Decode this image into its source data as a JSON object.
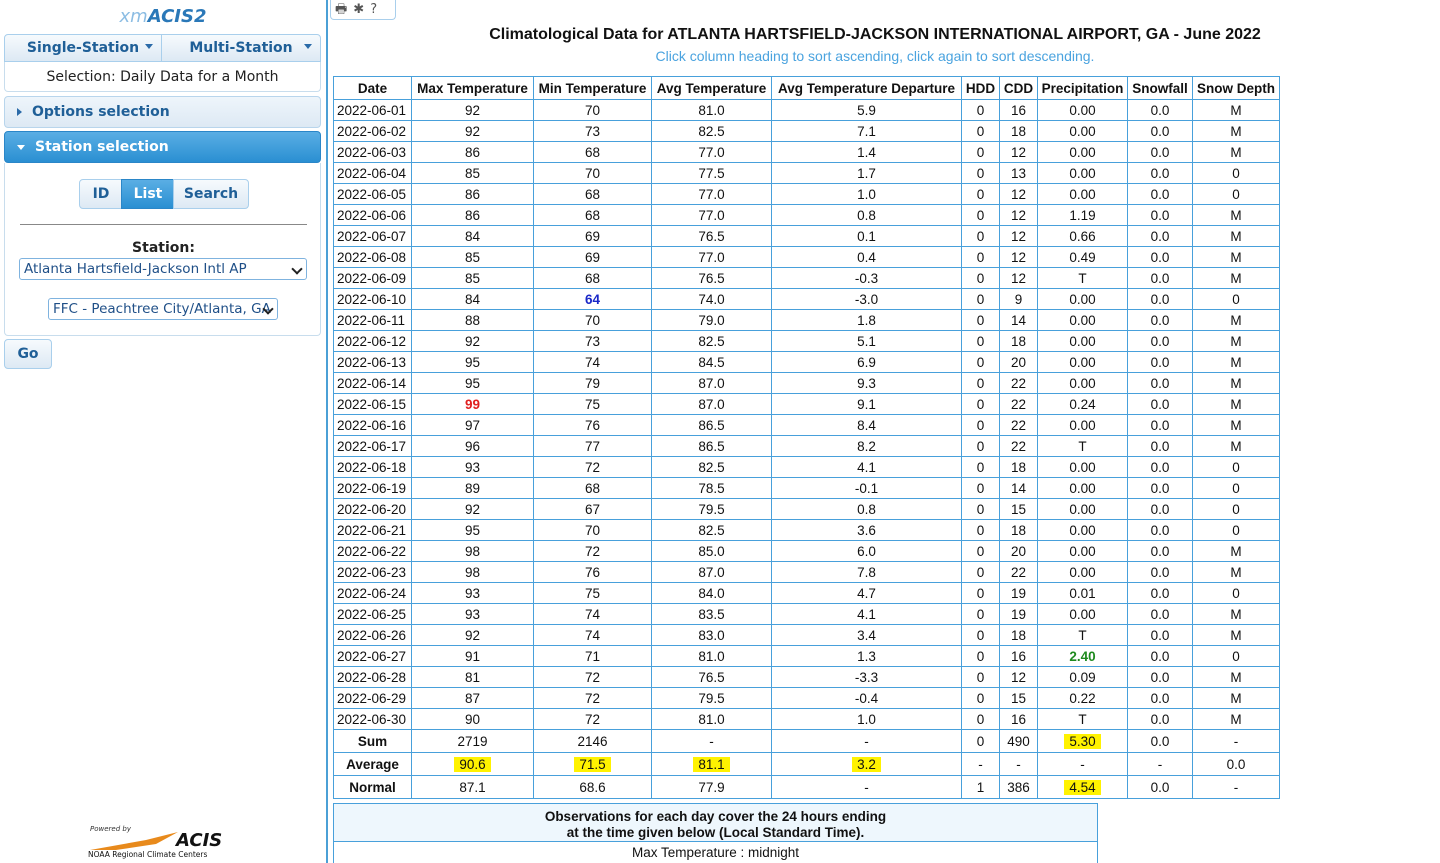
{
  "sidebar": {
    "app_title_prefix": "xm",
    "app_title_main": "ACIS2",
    "single_station_label": "Single-Station",
    "multi_station_label": "Multi-Station",
    "selection_text": "Selection: Daily Data for a Month",
    "options_label": "Options selection",
    "station_selection_label": "Station selection",
    "seg_id": "ID",
    "seg_list": "List",
    "seg_search": "Search",
    "station_label": "Station:",
    "station_value": "Atlanta Hartsfield-Jackson Intl AP",
    "network_value": "FFC - Peachtree City/Atlanta, GA",
    "go_label": "Go",
    "logo_powered": "Powered by",
    "logo_name": "ACIS",
    "logo_sub": "NOAA Regional Climate Centers"
  },
  "toolbar": {
    "print_icon": "🖶",
    "gear_icon": "✱",
    "help_icon": "?"
  },
  "report": {
    "title": "Climatological Data for ATLANTA HARTSFIELD-JACKSON INTERNATIONAL AIRPORT, GA - June 2022",
    "subtitle": "Click column heading to sort ascending, click again to sort descending."
  },
  "table": {
    "columns": [
      "Date",
      "Max Temperature",
      "Min Temperature",
      "Avg Temperature",
      "Avg Temperature Departure",
      "HDD",
      "CDD",
      "Precipitation",
      "Snowfall",
      "Snow Depth"
    ],
    "rows": [
      [
        "2022-06-01",
        "92",
        "70",
        "81.0",
        "5.9",
        "0",
        "16",
        "0.00",
        "0.0",
        "M"
      ],
      [
        "2022-06-02",
        "92",
        "73",
        "82.5",
        "7.1",
        "0",
        "18",
        "0.00",
        "0.0",
        "M"
      ],
      [
        "2022-06-03",
        "86",
        "68",
        "77.0",
        "1.4",
        "0",
        "12",
        "0.00",
        "0.0",
        "M"
      ],
      [
        "2022-06-04",
        "85",
        "70",
        "77.5",
        "1.7",
        "0",
        "13",
        "0.00",
        "0.0",
        "0"
      ],
      [
        "2022-06-05",
        "86",
        "68",
        "77.0",
        "1.0",
        "0",
        "12",
        "0.00",
        "0.0",
        "0"
      ],
      [
        "2022-06-06",
        "86",
        "68",
        "77.0",
        "0.8",
        "0",
        "12",
        "1.19",
        "0.0",
        "M"
      ],
      [
        "2022-06-07",
        "84",
        "69",
        "76.5",
        "0.1",
        "0",
        "12",
        "0.66",
        "0.0",
        "M"
      ],
      [
        "2022-06-08",
        "85",
        "69",
        "77.0",
        "0.4",
        "0",
        "12",
        "0.49",
        "0.0",
        "M"
      ],
      [
        "2022-06-09",
        "85",
        "68",
        "76.5",
        "-0.3",
        "0",
        "12",
        "T",
        "0.0",
        "M"
      ],
      [
        "2022-06-10",
        "84",
        "64",
        "74.0",
        "-3.0",
        "0",
        "9",
        "0.00",
        "0.0",
        "0"
      ],
      [
        "2022-06-11",
        "88",
        "70",
        "79.0",
        "1.8",
        "0",
        "14",
        "0.00",
        "0.0",
        "M"
      ],
      [
        "2022-06-12",
        "92",
        "73",
        "82.5",
        "5.1",
        "0",
        "18",
        "0.00",
        "0.0",
        "M"
      ],
      [
        "2022-06-13",
        "95",
        "74",
        "84.5",
        "6.9",
        "0",
        "20",
        "0.00",
        "0.0",
        "M"
      ],
      [
        "2022-06-14",
        "95",
        "79",
        "87.0",
        "9.3",
        "0",
        "22",
        "0.00",
        "0.0",
        "M"
      ],
      [
        "2022-06-15",
        "99",
        "75",
        "87.0",
        "9.1",
        "0",
        "22",
        "0.24",
        "0.0",
        "M"
      ],
      [
        "2022-06-16",
        "97",
        "76",
        "86.5",
        "8.4",
        "0",
        "22",
        "0.00",
        "0.0",
        "M"
      ],
      [
        "2022-06-17",
        "96",
        "77",
        "86.5",
        "8.2",
        "0",
        "22",
        "T",
        "0.0",
        "M"
      ],
      [
        "2022-06-18",
        "93",
        "72",
        "82.5",
        "4.1",
        "0",
        "18",
        "0.00",
        "0.0",
        "0"
      ],
      [
        "2022-06-19",
        "89",
        "68",
        "78.5",
        "-0.1",
        "0",
        "14",
        "0.00",
        "0.0",
        "0"
      ],
      [
        "2022-06-20",
        "92",
        "67",
        "79.5",
        "0.8",
        "0",
        "15",
        "0.00",
        "0.0",
        "0"
      ],
      [
        "2022-06-21",
        "95",
        "70",
        "82.5",
        "3.6",
        "0",
        "18",
        "0.00",
        "0.0",
        "0"
      ],
      [
        "2022-06-22",
        "98",
        "72",
        "85.0",
        "6.0",
        "0",
        "20",
        "0.00",
        "0.0",
        "M"
      ],
      [
        "2022-06-23",
        "98",
        "76",
        "87.0",
        "7.8",
        "0",
        "22",
        "0.00",
        "0.0",
        "M"
      ],
      [
        "2022-06-24",
        "93",
        "75",
        "84.0",
        "4.7",
        "0",
        "19",
        "0.01",
        "0.0",
        "0"
      ],
      [
        "2022-06-25",
        "93",
        "74",
        "83.5",
        "4.1",
        "0",
        "19",
        "0.00",
        "0.0",
        "M"
      ],
      [
        "2022-06-26",
        "92",
        "74",
        "83.0",
        "3.4",
        "0",
        "18",
        "T",
        "0.0",
        "M"
      ],
      [
        "2022-06-27",
        "91",
        "71",
        "81.0",
        "1.3",
        "0",
        "16",
        "2.40",
        "0.0",
        "0"
      ],
      [
        "2022-06-28",
        "81",
        "72",
        "76.5",
        "-3.3",
        "0",
        "12",
        "0.09",
        "0.0",
        "M"
      ],
      [
        "2022-06-29",
        "87",
        "72",
        "79.5",
        "-0.4",
        "0",
        "15",
        "0.22",
        "0.0",
        "M"
      ],
      [
        "2022-06-30",
        "90",
        "72",
        "81.0",
        "1.0",
        "0",
        "16",
        "T",
        "0.0",
        "M"
      ]
    ],
    "emphasis": [
      {
        "row": 14,
        "col": 1,
        "color": "#e02020"
      },
      {
        "row": 9,
        "col": 2,
        "color": "#1a28c8"
      },
      {
        "row": 26,
        "col": 7,
        "color": "#1e8a1e"
      }
    ],
    "summary": [
      {
        "label": "Sum",
        "values": [
          "2719",
          "2146",
          "-",
          "-",
          "0",
          "490",
          "5.30",
          "0.0",
          "-"
        ],
        "highlight": [
          6
        ]
      },
      {
        "label": "Average",
        "values": [
          "90.6",
          "71.5",
          "81.1",
          "3.2",
          "-",
          "-",
          "-",
          "-",
          "0.0"
        ],
        "highlight": [
          0,
          1,
          2,
          3
        ]
      },
      {
        "label": "Normal",
        "values": [
          "87.1",
          "68.6",
          "77.9",
          "-",
          "1",
          "386",
          "4.54",
          "0.0",
          "-"
        ],
        "highlight": [
          6
        ]
      }
    ],
    "highlight_color": "#fff200"
  },
  "observations": {
    "title_line1": "Observations for each day cover the 24 hours ending",
    "title_line2": "at the time given below (Local Standard Time).",
    "line": "Max Temperature : midnight"
  }
}
